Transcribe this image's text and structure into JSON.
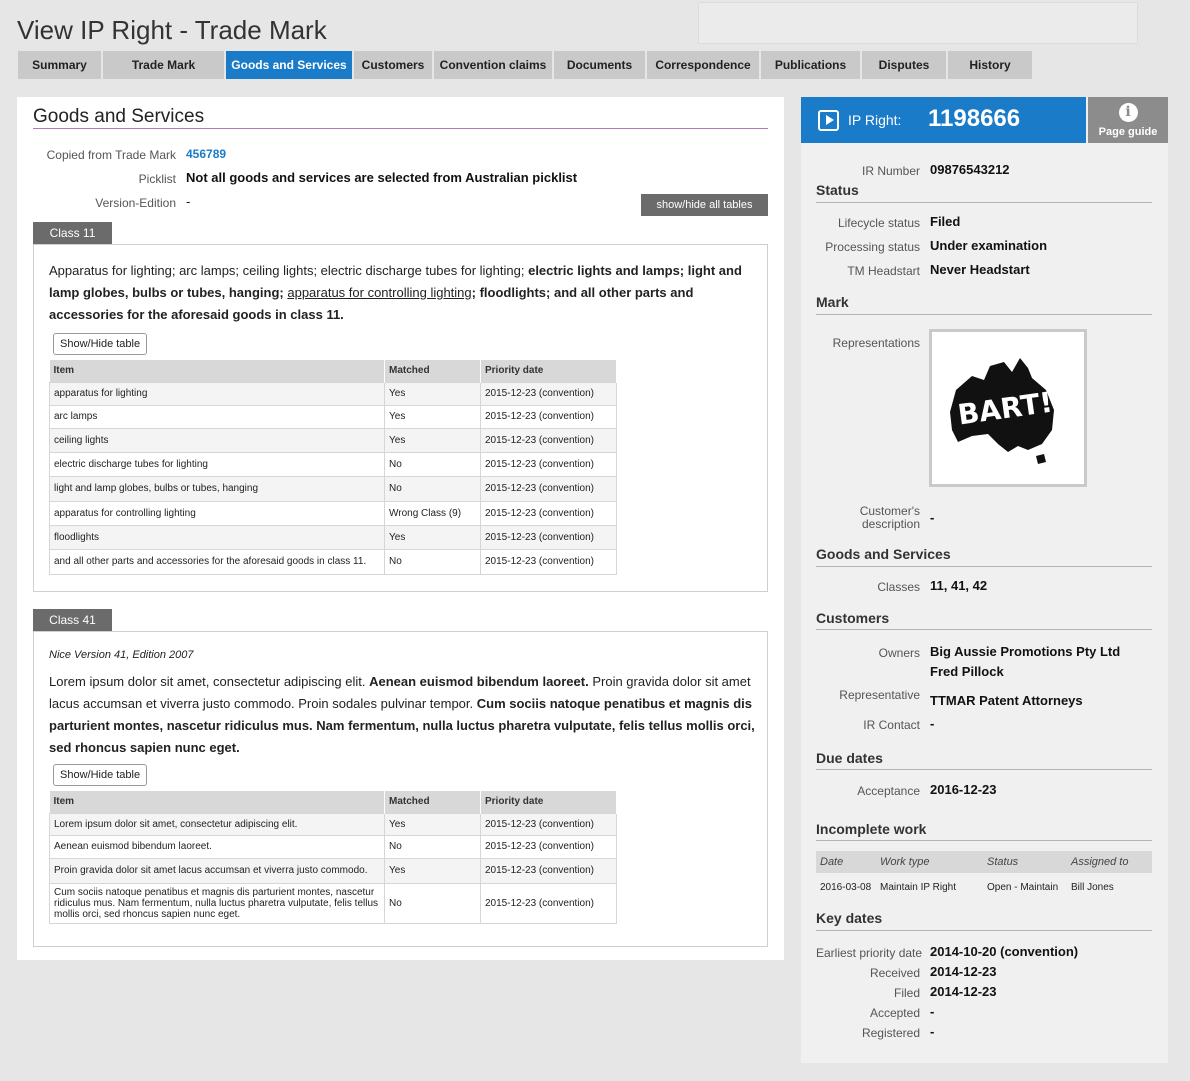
{
  "page_title": "View IP Right - Trade Mark",
  "tabs": [
    {
      "label": "Summary",
      "active": false
    },
    {
      "label": "Trade Mark",
      "active": false
    },
    {
      "label": "Goods and Services",
      "active": true
    },
    {
      "label": "Customers",
      "active": false
    },
    {
      "label": "Convention claims",
      "active": false
    },
    {
      "label": "Documents",
      "active": false
    },
    {
      "label": "Correspondence",
      "active": false
    },
    {
      "label": "Publications",
      "active": false
    },
    {
      "label": "Disputes",
      "active": false
    },
    {
      "label": "History",
      "active": false
    }
  ],
  "main": {
    "title": "Goods and Services",
    "copied_label": "Copied from Trade Mark",
    "copied_value": "456789",
    "picklist_label": "Picklist",
    "picklist_value": "Not all goods and services are selected from Australian picklist",
    "version_label": "Version-Edition",
    "version_value": "-",
    "show_hide_all": "show/hide all tables",
    "show_hide_table": "Show/Hide table",
    "table_headers": [
      "Item",
      "Matched",
      "Priority date"
    ],
    "class11": {
      "tab": "Class 11",
      "desc": {
        "p1": "Apparatus for lighting; arc lamps; ceiling lights; electric discharge tubes for lighting;",
        "b1": "electric lights and lamps; light and lamp globes, bulbs or tubes, hanging;",
        "u1": "apparatus for controlling lighting",
        "p2": "; floodlights;",
        "b2": "and all other parts and accessories for the aforesaid goods in class 11."
      },
      "rows": [
        {
          "item": "apparatus for lighting",
          "matched": "Yes",
          "date": "2015-12-23 (convention)"
        },
        {
          "item": "arc lamps",
          "matched": "Yes",
          "date": "2015-12-23 (convention)"
        },
        {
          "item": "ceiling lights",
          "matched": "Yes",
          "date": "2015-12-23 (convention)"
        },
        {
          "item": "electric discharge tubes for lighting",
          "matched": "No",
          "date": "2015-12-23 (convention)"
        },
        {
          "item": "light and lamp globes, bulbs or tubes, hanging",
          "matched": "No",
          "date": "2015-12-23 (convention)"
        },
        {
          "item": "apparatus for controlling lighting",
          "matched": "Wrong Class (9)",
          "date": "2015-12-23 (convention)"
        },
        {
          "item": "floodlights",
          "matched": "Yes",
          "date": "2015-12-23 (convention)"
        },
        {
          "item": "and all other parts and accessories for the aforesaid goods in class 11.",
          "matched": "No",
          "date": "2015-12-23 (convention)"
        }
      ]
    },
    "class41": {
      "tab": "Class 41",
      "nice": "Nice Version 41, Edition 2007",
      "desc": {
        "p1": "Lorem ipsum dolor sit amet, consectetur adipiscing elit.",
        "b1": "Aenean euismod bibendum laoreet.",
        "p2": "Proin gravida dolor sit amet lacus accumsan et viverra justo commodo. Proin sodales pulvinar tempor.",
        "b2": "Cum sociis natoque penatibus et magnis dis parturient montes, nascetur ridiculus mus. Nam fermentum, nulla luctus pharetra vulputate, felis tellus mollis orci, sed rhoncus sapien nunc eget."
      },
      "rows": [
        {
          "item": "Lorem ipsum dolor sit amet, consectetur adipiscing elit.",
          "matched": "Yes",
          "date": "2015-12-23 (convention)"
        },
        {
          "item": "Aenean euismod bibendum laoreet.",
          "matched": "No",
          "date": "2015-12-23 (convention)"
        },
        {
          "item": "Proin gravida dolor sit amet lacus accumsan et viverra justo commodo.",
          "matched": "Yes",
          "date": "2015-12-23 (convention)"
        },
        {
          "item": "Cum sociis natoque penatibus et magnis dis parturient montes, nascetur ridiculus mus. Nam fermentum, nulla luctus pharetra vulputate, felis tellus mollis orci, sed rhoncus sapien nunc eget.",
          "matched": "No",
          "date": "2015-12-23 (convention)"
        }
      ]
    }
  },
  "side": {
    "ip_right_label": "IP Right:",
    "ip_right_number": "1198666",
    "page_guide": "Page guide",
    "ir_number_label": "IR Number",
    "ir_number": "09876543212",
    "status_heading": "Status",
    "lifecycle_label": "Lifecycle status",
    "lifecycle": "Filed",
    "processing_label": "Processing status",
    "processing": "Under examination",
    "headstart_label": "TM Headstart",
    "headstart": "Never Headstart",
    "mark_heading": "Mark",
    "representations_label": "Representations",
    "logo_text": "BART!",
    "customer_desc_label_1": "Customer's",
    "customer_desc_label_2": "description",
    "customer_desc": "-",
    "gs_heading": "Goods and Services",
    "classes_label": "Classes",
    "classes": "11, 41, 42",
    "customers_heading": "Customers",
    "owners_label": "Owners",
    "owner1": "Big Aussie Promotions Pty Ltd",
    "owner2": "Fred Pillock",
    "rep_label": "Representative",
    "rep": "TTMAR Patent Attorneys",
    "ircontact_label": "IR Contact",
    "ircontact": "-",
    "due_heading": "Due dates",
    "acceptance_label": "Acceptance",
    "acceptance": "2016-12-23",
    "incomplete_heading": "Incomplete work",
    "iw_headers": [
      "Date",
      "Work type",
      "Status",
      "Assigned to"
    ],
    "iw_row": {
      "date": "2016-03-08",
      "type": "Maintain IP Right",
      "status": "Open - Maintain",
      "assigned": "Bill Jones"
    },
    "key_heading": "Key dates",
    "earliest_label": "Earliest priority date",
    "earliest": "2014-10-20 (convention)",
    "received_label": "Received",
    "received": "2014-12-23",
    "filed_label": "Filed",
    "filed": "2014-12-23",
    "accepted_label": "Accepted",
    "accepted": "-",
    "registered_label": "Registered",
    "registered": "-"
  }
}
